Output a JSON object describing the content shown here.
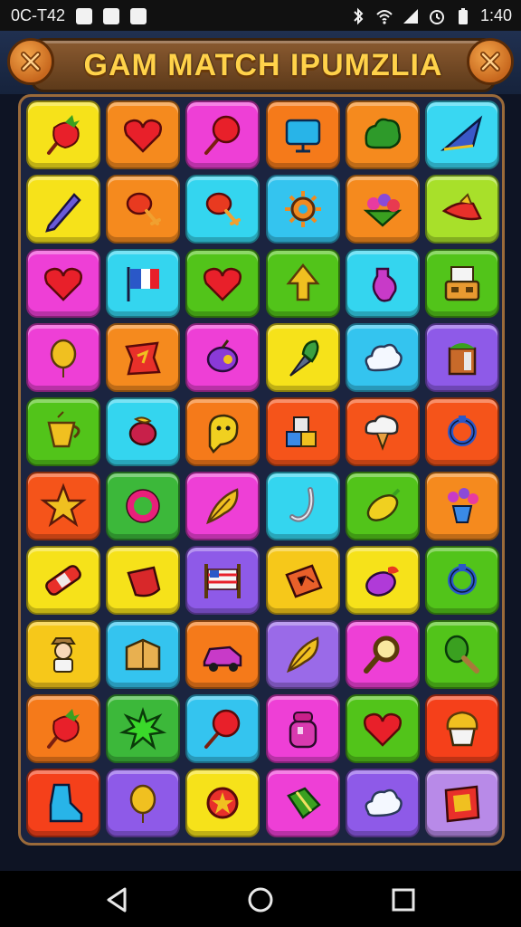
{
  "status_bar": {
    "time_left": "0C-T42",
    "time_right": "1:40",
    "left_icons": [
      "notification-icon",
      "shield-icon",
      "image-icon"
    ],
    "right_icons": [
      "bluetooth-icon",
      "wifi-icon",
      "signal-icon",
      "alarm-icon",
      "battery-icon"
    ]
  },
  "header": {
    "title": "GAM MATCH IPUMZLIA",
    "left_button_icon": "close-icon",
    "right_button_icon": "close-icon"
  },
  "board": {
    "columns": 6,
    "rows": 10,
    "tiles": [
      {
        "color": "#f6e21a",
        "icon": "strawberry"
      },
      {
        "color": "#f58a1e",
        "icon": "heart"
      },
      {
        "color": "#ee3fd6",
        "icon": "lollipop"
      },
      {
        "color": "#f57a1a",
        "icon": "screen"
      },
      {
        "color": "#f58a1e",
        "icon": "bush"
      },
      {
        "color": "#39d7f2",
        "icon": "kite"
      },
      {
        "color": "#f6e21a",
        "icon": "pencil"
      },
      {
        "color": "#f58a1e",
        "icon": "drumstick"
      },
      {
        "color": "#34d5ef",
        "icon": "drumstick"
      },
      {
        "color": "#34c4ef",
        "icon": "gear"
      },
      {
        "color": "#f58a1e",
        "icon": "flowers"
      },
      {
        "color": "#a8e02a",
        "icon": "hat"
      },
      {
        "color": "#ee3fd6",
        "icon": "heart"
      },
      {
        "color": "#34d5ef",
        "icon": "flag"
      },
      {
        "color": "#52c41a",
        "icon": "heart"
      },
      {
        "color": "#52c41a",
        "icon": "arrow"
      },
      {
        "color": "#34d5ef",
        "icon": "bottle"
      },
      {
        "color": "#52c41a",
        "icon": "register"
      },
      {
        "color": "#ee3fd6",
        "icon": "balloon"
      },
      {
        "color": "#f58a1e",
        "icon": "scroll"
      },
      {
        "color": "#ee3fd6",
        "icon": "fruit"
      },
      {
        "color": "#f6e21a",
        "icon": "pen"
      },
      {
        "color": "#34c4ef",
        "icon": "cloud"
      },
      {
        "color": "#8e5ae8",
        "icon": "crate"
      },
      {
        "color": "#52c41a",
        "icon": "cup"
      },
      {
        "color": "#34d5ef",
        "icon": "candy"
      },
      {
        "color": "#f57a1a",
        "icon": "ghost"
      },
      {
        "color": "#f5541a",
        "icon": "blocks"
      },
      {
        "color": "#f5541a",
        "icon": "icecream"
      },
      {
        "color": "#f5541a",
        "icon": "ring"
      },
      {
        "color": "#f5541a",
        "icon": "star"
      },
      {
        "color": "#3cb83a",
        "icon": "donut"
      },
      {
        "color": "#ee3fd6",
        "icon": "feather"
      },
      {
        "color": "#34d5ef",
        "icon": "hook"
      },
      {
        "color": "#52c41a",
        "icon": "lemon"
      },
      {
        "color": "#f58a1e",
        "icon": "bouquet"
      },
      {
        "color": "#f6e21a",
        "icon": "bandage"
      },
      {
        "color": "#f6e21a",
        "icon": "pot"
      },
      {
        "color": "#8e5ae8",
        "icon": "banner"
      },
      {
        "color": "#f6c81a",
        "icon": "tag"
      },
      {
        "color": "#f6e21a",
        "icon": "eggplant"
      },
      {
        "color": "#52c41a",
        "icon": "ring"
      },
      {
        "color": "#f6c81a",
        "icon": "person"
      },
      {
        "color": "#34c4ef",
        "icon": "box"
      },
      {
        "color": "#f57a1a",
        "icon": "car"
      },
      {
        "color": "#9a6ae8",
        "icon": "feather"
      },
      {
        "color": "#ee3fd6",
        "icon": "magnifier"
      },
      {
        "color": "#52c41a",
        "icon": "maraca"
      },
      {
        "color": "#f57a1a",
        "icon": "strawberry"
      },
      {
        "color": "#3cb83a",
        "icon": "splat"
      },
      {
        "color": "#34c4ef",
        "icon": "lollipop"
      },
      {
        "color": "#ee3fd6",
        "icon": "jar"
      },
      {
        "color": "#52c41a",
        "icon": "heart"
      },
      {
        "color": "#f5401a",
        "icon": "cupcake"
      },
      {
        "color": "#f5401a",
        "icon": "boot"
      },
      {
        "color": "#8e5ae8",
        "icon": "balloon"
      },
      {
        "color": "#f6e21a",
        "icon": "badge"
      },
      {
        "color": "#ee3fd6",
        "icon": "gift"
      },
      {
        "color": "#8e5ae8",
        "icon": "cloud"
      },
      {
        "color": "#b88ae8",
        "icon": "map"
      }
    ]
  },
  "nav_bar": {
    "back_icon": "back-icon",
    "home_icon": "home-icon",
    "recents_icon": "recents-icon"
  }
}
